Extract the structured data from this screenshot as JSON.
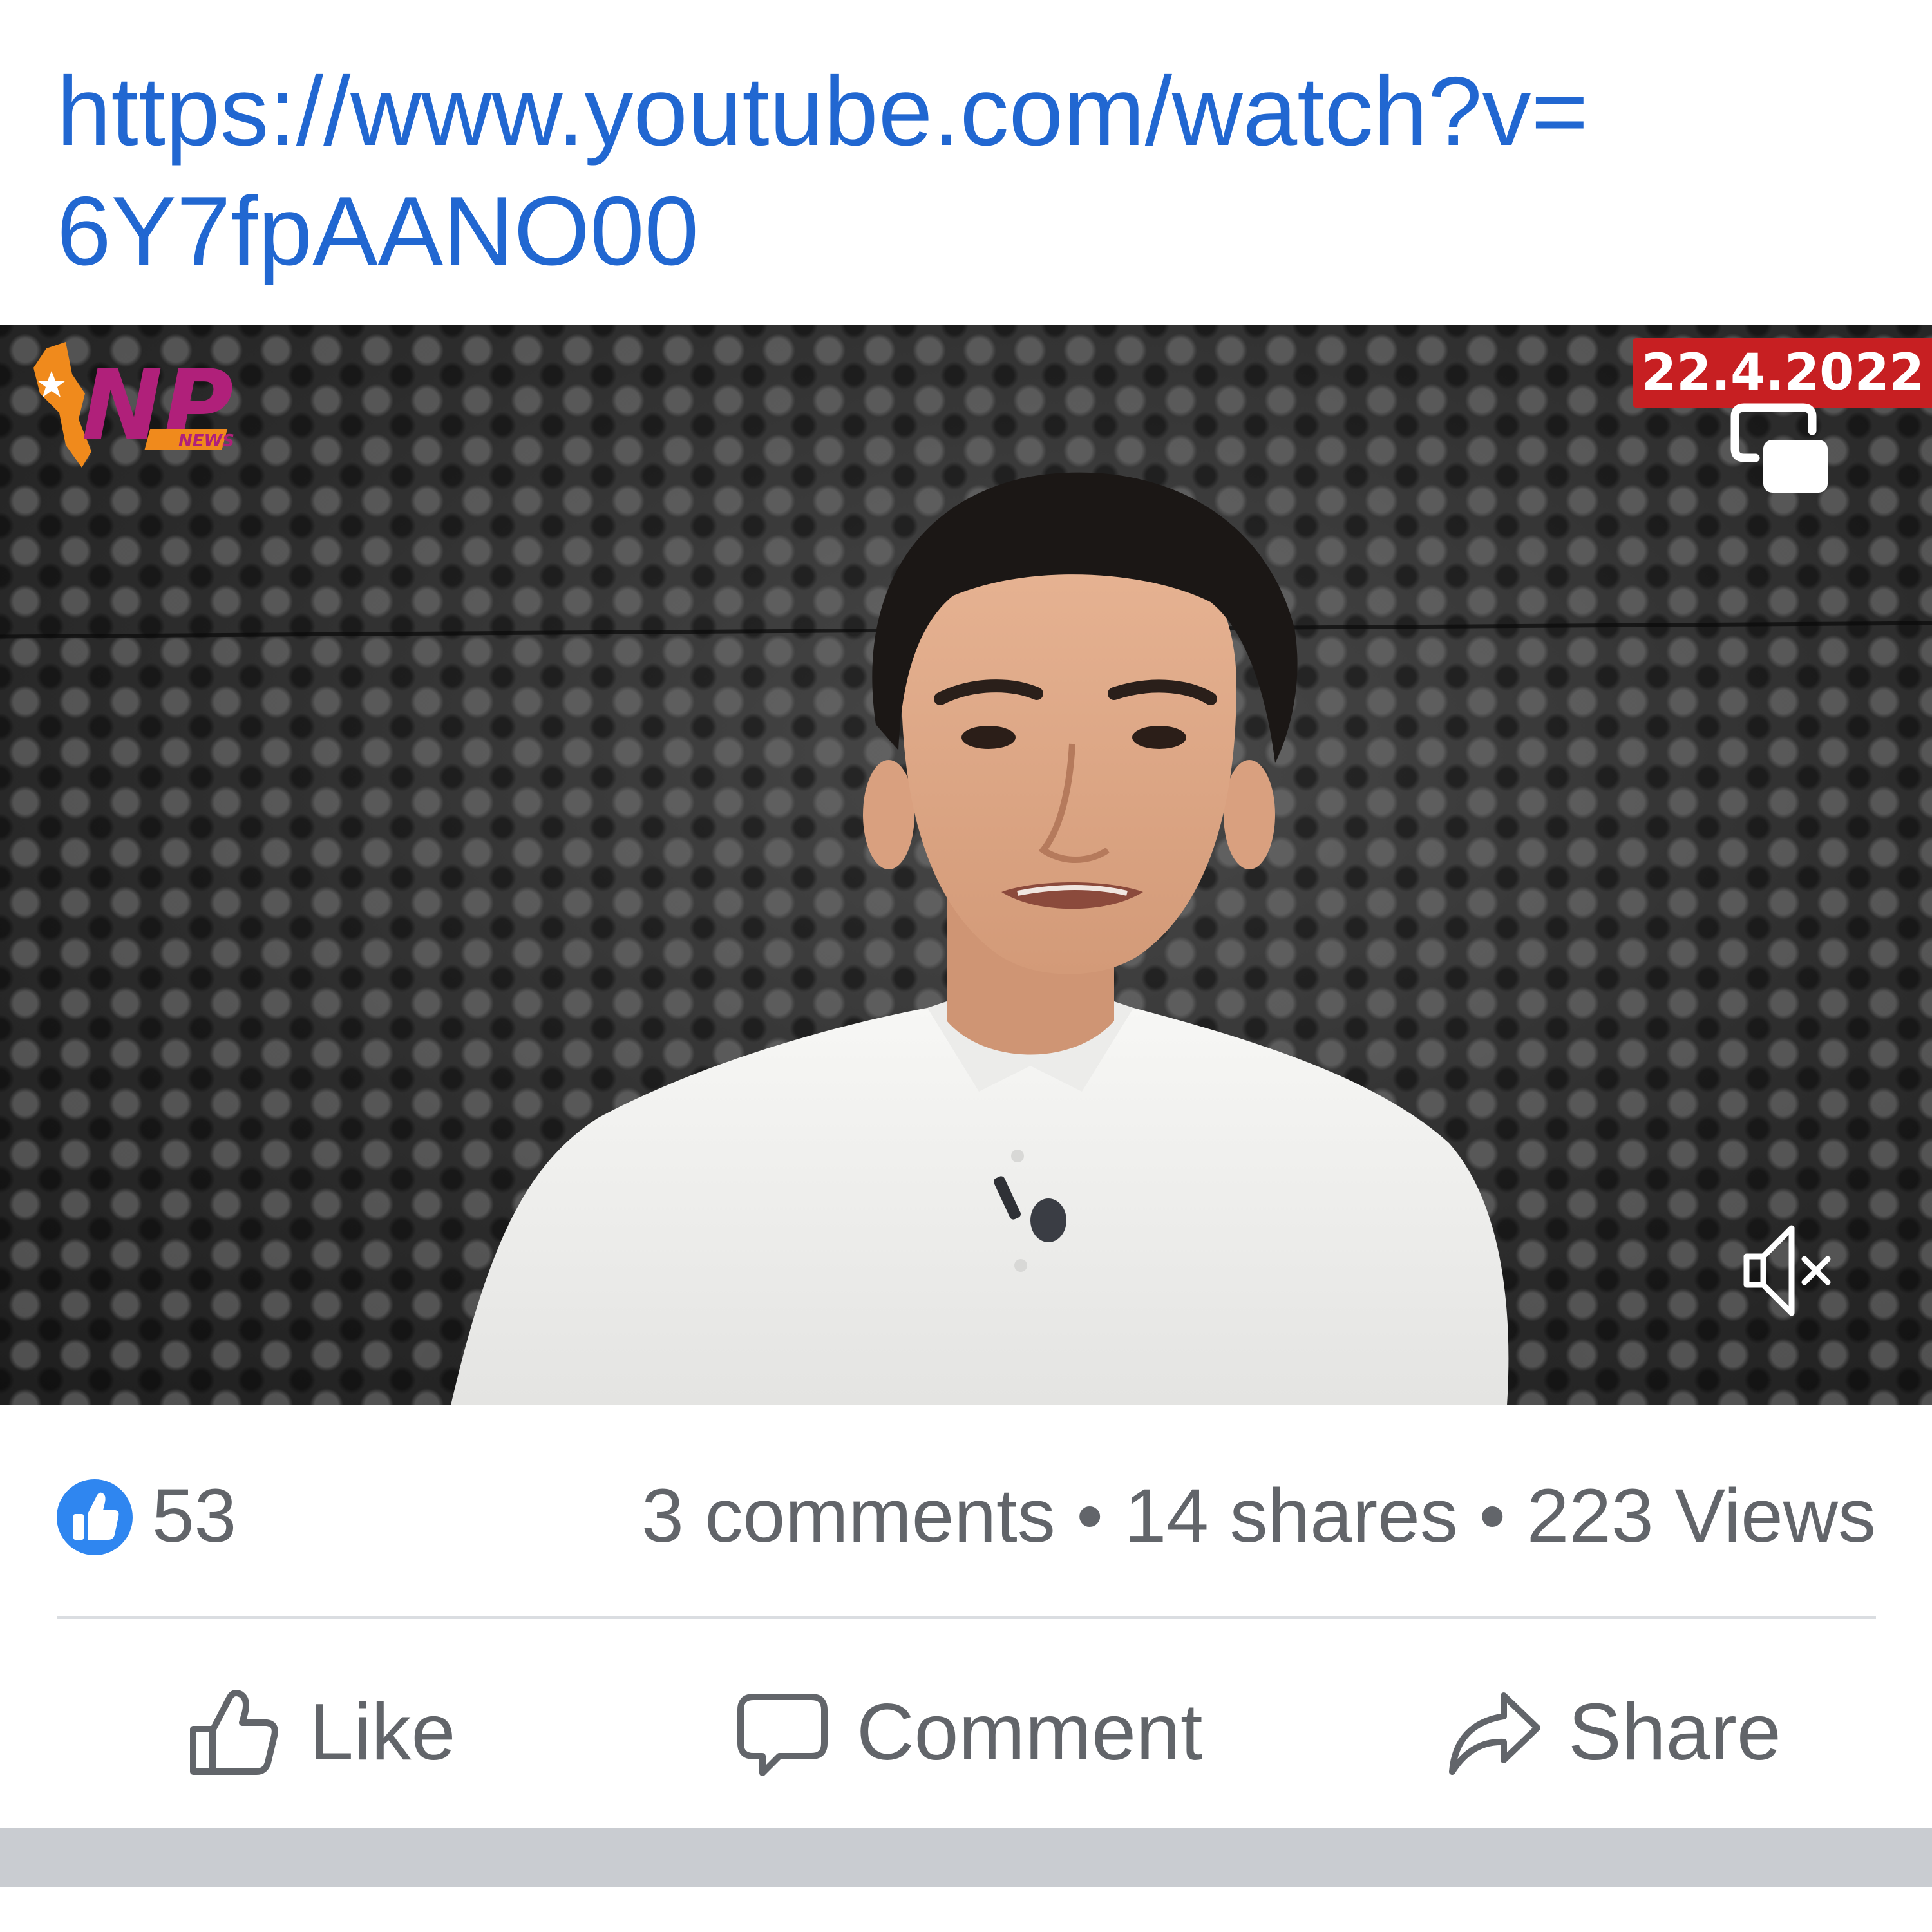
{
  "post": {
    "link_line1": "https://www.youtube.com/watch?v=",
    "link_line2": "6Y7fpAANO00"
  },
  "video": {
    "logo_text": "NP",
    "logo_sub": "NEWS",
    "date_badge": "22.4.2022",
    "pip_icon": "picture-in-picture-icon",
    "mute_icon": "volume-muted-icon"
  },
  "stats": {
    "like_icon": "thumbs-up-icon",
    "like_count": "53",
    "engagement": "3 comments • 14 shares • 223 Views"
  },
  "actions": {
    "like_label": "Like",
    "comment_label": "Comment",
    "share_label": "Share"
  },
  "colors": {
    "link": "#2167d1",
    "like_badge": "#2f86f0",
    "date_badge": "#c71f22",
    "text_muted": "#62656a",
    "logo_primary": "#b0207a",
    "logo_accent": "#f08a1c"
  }
}
